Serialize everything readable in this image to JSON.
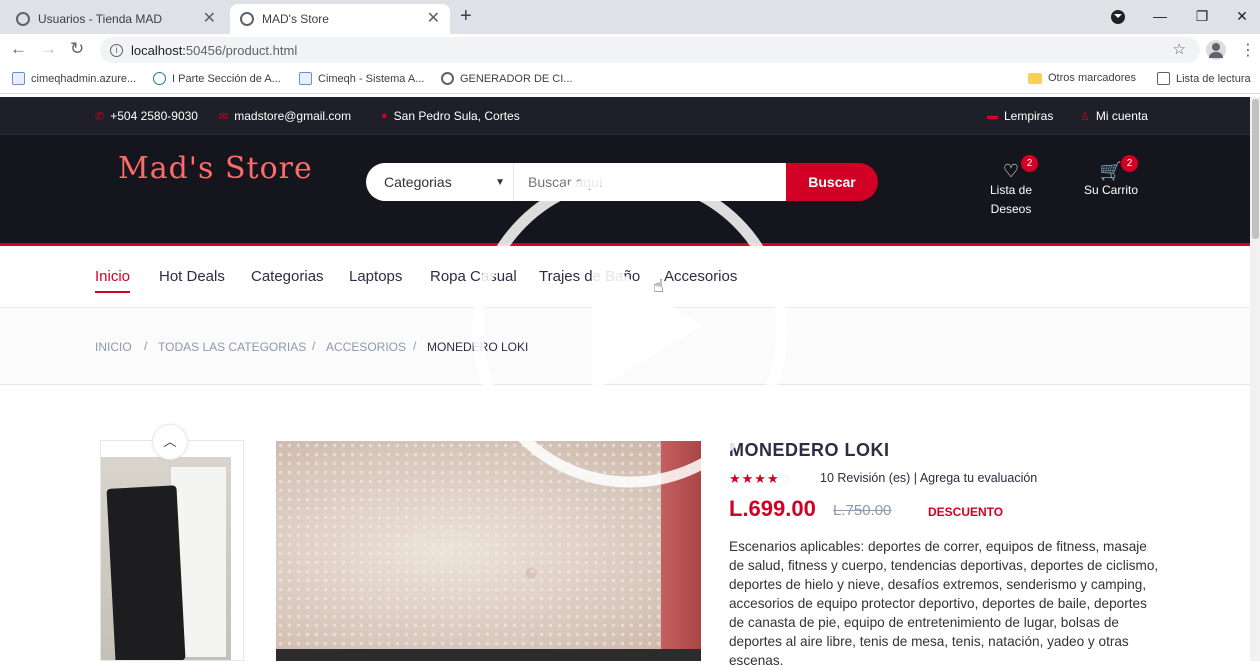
{
  "browser": {
    "tabs": [
      {
        "title": "Usuarios - Tienda MAD",
        "active": false
      },
      {
        "title": "MAD's Store",
        "active": true
      }
    ],
    "url_host": "localhost:",
    "url_path": "50456/product.html",
    "bookmarks": [
      {
        "label": "cimeqhadmin.azure...",
        "icon": "document-icon"
      },
      {
        "label": "I Parte Sección de A...",
        "icon": "wordpress-icon"
      },
      {
        "label": "Cimeqh - Sistema A...",
        "icon": "document-icon"
      },
      {
        "label": "GENERADOR DE CI...",
        "icon": "globe-icon"
      }
    ],
    "other_bookmarks": "Otros marcadores",
    "reading_list": "Lista de lectura"
  },
  "topbar": {
    "phone": "+504 2580-9030",
    "email": "madstore@gmail.com",
    "location": "San Pedro Sula, Cortes",
    "currency": "Lempiras",
    "account": "Mi cuenta"
  },
  "header": {
    "logo": "Mad's Store",
    "category_select": "Categorias",
    "search_placeholder": "Buscar aquí",
    "search_button": "Buscar",
    "wishlist_line1": "Lista de",
    "wishlist_line2": "Deseos",
    "wishlist_count": "2",
    "cart_label": "Su Carrito",
    "cart_count": "2"
  },
  "nav": [
    "Inicio",
    "Hot Deals",
    "Categorias",
    "Laptops",
    "Ropa Casual",
    "Trajes de Baño",
    "Accesorios"
  ],
  "breadcrumb": [
    "Inicio",
    "Todas las categorias",
    "Accesorios",
    "Monedero Loki"
  ],
  "product": {
    "name": "MONEDERO LOKI",
    "rating": 4,
    "rating_max": 5,
    "reviews": "10 Revisión (es) | Agrega tu evaluación",
    "price": "L.699.00",
    "old_price": "L.750.00",
    "discount": "DESCUENTO",
    "description": "Escenarios aplicables: deportes de correr, equipos de fitness, masaje de salud, fitness y cuerpo, tendencias deportivas, deportes de ciclismo, deportes de hielo y nieve, desafíos extremos, senderismo y camping, accesorios de equipo protector deportivo, deportes de baile, deportes de canasta de pie, equipo de entretenimiento de lugar, bolsas de deportes al aire libre, tenis de mesa, tenis, natación, yadeo y otras escenas."
  },
  "colors": {
    "accent": "#d10024",
    "dark_header": "#15161d",
    "top_header": "#1e1f29"
  }
}
